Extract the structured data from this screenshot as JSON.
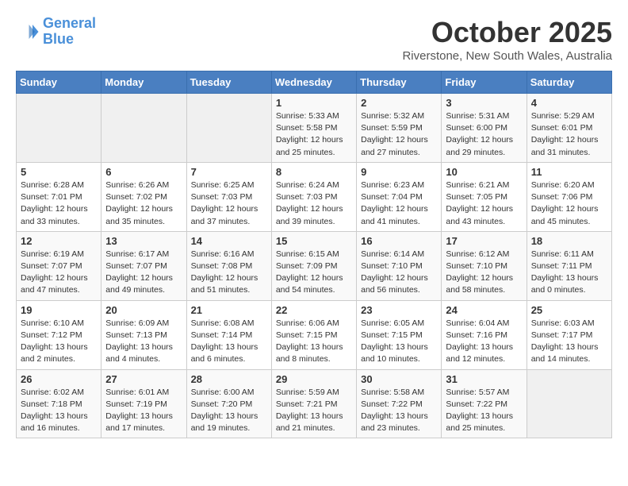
{
  "header": {
    "logo_line1": "General",
    "logo_line2": "Blue",
    "month": "October 2025",
    "location": "Riverstone, New South Wales, Australia"
  },
  "weekdays": [
    "Sunday",
    "Monday",
    "Tuesday",
    "Wednesday",
    "Thursday",
    "Friday",
    "Saturday"
  ],
  "weeks": [
    [
      {
        "day": "",
        "info": ""
      },
      {
        "day": "",
        "info": ""
      },
      {
        "day": "",
        "info": ""
      },
      {
        "day": "1",
        "info": "Sunrise: 5:33 AM\nSunset: 5:58 PM\nDaylight: 12 hours\nand 25 minutes."
      },
      {
        "day": "2",
        "info": "Sunrise: 5:32 AM\nSunset: 5:59 PM\nDaylight: 12 hours\nand 27 minutes."
      },
      {
        "day": "3",
        "info": "Sunrise: 5:31 AM\nSunset: 6:00 PM\nDaylight: 12 hours\nand 29 minutes."
      },
      {
        "day": "4",
        "info": "Sunrise: 5:29 AM\nSunset: 6:01 PM\nDaylight: 12 hours\nand 31 minutes."
      }
    ],
    [
      {
        "day": "5",
        "info": "Sunrise: 6:28 AM\nSunset: 7:01 PM\nDaylight: 12 hours\nand 33 minutes."
      },
      {
        "day": "6",
        "info": "Sunrise: 6:26 AM\nSunset: 7:02 PM\nDaylight: 12 hours\nand 35 minutes."
      },
      {
        "day": "7",
        "info": "Sunrise: 6:25 AM\nSunset: 7:03 PM\nDaylight: 12 hours\nand 37 minutes."
      },
      {
        "day": "8",
        "info": "Sunrise: 6:24 AM\nSunset: 7:03 PM\nDaylight: 12 hours\nand 39 minutes."
      },
      {
        "day": "9",
        "info": "Sunrise: 6:23 AM\nSunset: 7:04 PM\nDaylight: 12 hours\nand 41 minutes."
      },
      {
        "day": "10",
        "info": "Sunrise: 6:21 AM\nSunset: 7:05 PM\nDaylight: 12 hours\nand 43 minutes."
      },
      {
        "day": "11",
        "info": "Sunrise: 6:20 AM\nSunset: 7:06 PM\nDaylight: 12 hours\nand 45 minutes."
      }
    ],
    [
      {
        "day": "12",
        "info": "Sunrise: 6:19 AM\nSunset: 7:07 PM\nDaylight: 12 hours\nand 47 minutes."
      },
      {
        "day": "13",
        "info": "Sunrise: 6:17 AM\nSunset: 7:07 PM\nDaylight: 12 hours\nand 49 minutes."
      },
      {
        "day": "14",
        "info": "Sunrise: 6:16 AM\nSunset: 7:08 PM\nDaylight: 12 hours\nand 51 minutes."
      },
      {
        "day": "15",
        "info": "Sunrise: 6:15 AM\nSunset: 7:09 PM\nDaylight: 12 hours\nand 54 minutes."
      },
      {
        "day": "16",
        "info": "Sunrise: 6:14 AM\nSunset: 7:10 PM\nDaylight: 12 hours\nand 56 minutes."
      },
      {
        "day": "17",
        "info": "Sunrise: 6:12 AM\nSunset: 7:10 PM\nDaylight: 12 hours\nand 58 minutes."
      },
      {
        "day": "18",
        "info": "Sunrise: 6:11 AM\nSunset: 7:11 PM\nDaylight: 13 hours\nand 0 minutes."
      }
    ],
    [
      {
        "day": "19",
        "info": "Sunrise: 6:10 AM\nSunset: 7:12 PM\nDaylight: 13 hours\nand 2 minutes."
      },
      {
        "day": "20",
        "info": "Sunrise: 6:09 AM\nSunset: 7:13 PM\nDaylight: 13 hours\nand 4 minutes."
      },
      {
        "day": "21",
        "info": "Sunrise: 6:08 AM\nSunset: 7:14 PM\nDaylight: 13 hours\nand 6 minutes."
      },
      {
        "day": "22",
        "info": "Sunrise: 6:06 AM\nSunset: 7:15 PM\nDaylight: 13 hours\nand 8 minutes."
      },
      {
        "day": "23",
        "info": "Sunrise: 6:05 AM\nSunset: 7:15 PM\nDaylight: 13 hours\nand 10 minutes."
      },
      {
        "day": "24",
        "info": "Sunrise: 6:04 AM\nSunset: 7:16 PM\nDaylight: 13 hours\nand 12 minutes."
      },
      {
        "day": "25",
        "info": "Sunrise: 6:03 AM\nSunset: 7:17 PM\nDaylight: 13 hours\nand 14 minutes."
      }
    ],
    [
      {
        "day": "26",
        "info": "Sunrise: 6:02 AM\nSunset: 7:18 PM\nDaylight: 13 hours\nand 16 minutes."
      },
      {
        "day": "27",
        "info": "Sunrise: 6:01 AM\nSunset: 7:19 PM\nDaylight: 13 hours\nand 17 minutes."
      },
      {
        "day": "28",
        "info": "Sunrise: 6:00 AM\nSunset: 7:20 PM\nDaylight: 13 hours\nand 19 minutes."
      },
      {
        "day": "29",
        "info": "Sunrise: 5:59 AM\nSunset: 7:21 PM\nDaylight: 13 hours\nand 21 minutes."
      },
      {
        "day": "30",
        "info": "Sunrise: 5:58 AM\nSunset: 7:22 PM\nDaylight: 13 hours\nand 23 minutes."
      },
      {
        "day": "31",
        "info": "Sunrise: 5:57 AM\nSunset: 7:22 PM\nDaylight: 13 hours\nand 25 minutes."
      },
      {
        "day": "",
        "info": ""
      }
    ]
  ]
}
